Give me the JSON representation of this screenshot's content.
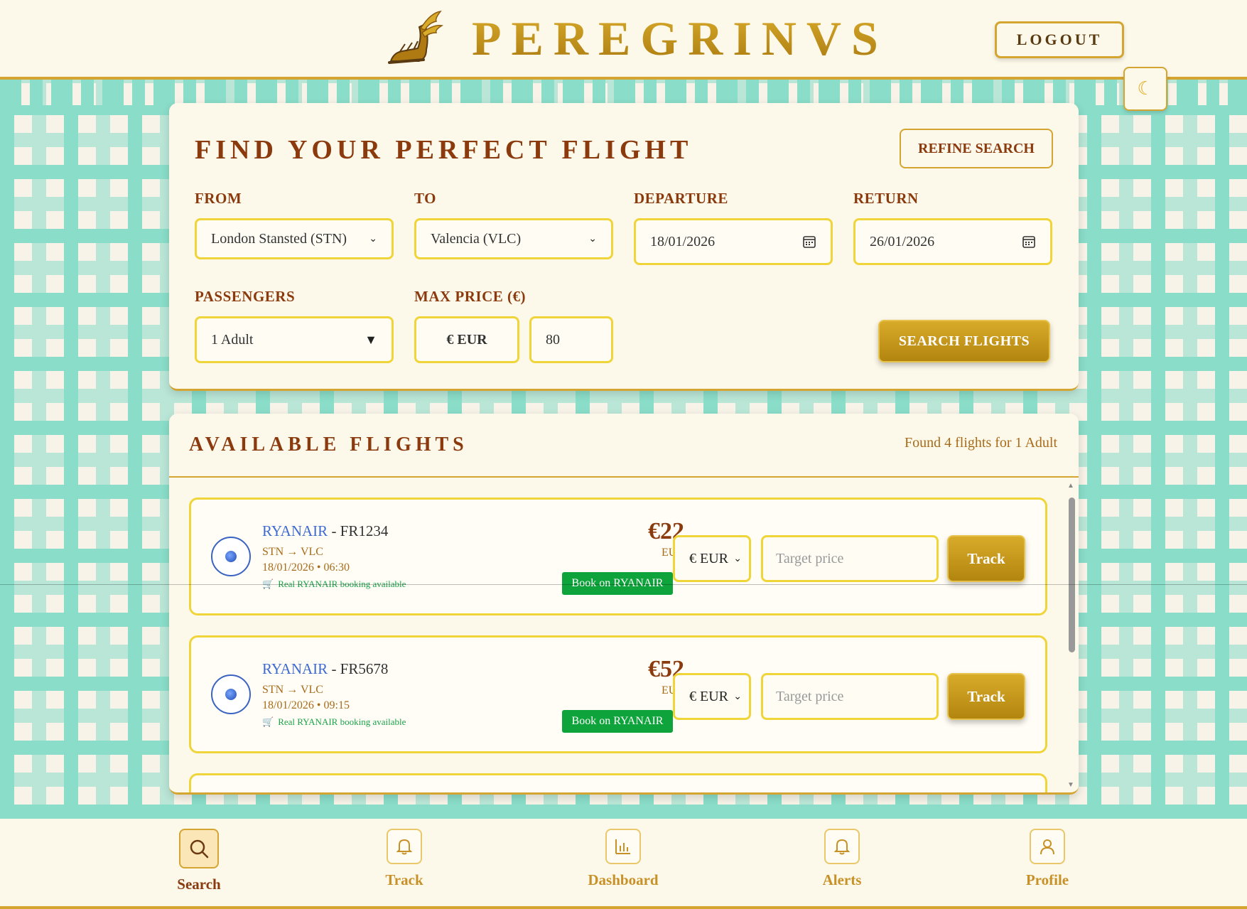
{
  "header": {
    "brand": "PEREGRINVS",
    "logout_label": "LOGOUT",
    "theme_icon": "moon-icon"
  },
  "search": {
    "title": "FIND YOUR PERFECT FLIGHT",
    "refine_label": "REFINE SEARCH",
    "from_label": "FROM",
    "from_value": "London Stansted (STN)",
    "to_label": "TO",
    "to_value": "Valencia (VLC)",
    "departure_label": "DEPARTURE",
    "departure_value": "18/01/2026",
    "return_label": "RETURN",
    "return_value": "26/01/2026",
    "passengers_label": "PASSENGERS",
    "passengers_value": "1 Adult",
    "max_price_label": "MAX PRICE (€)",
    "currency_value": "€ EUR",
    "max_price_value": "80",
    "search_label": "SEARCH FLIGHTS"
  },
  "results": {
    "title": "AVAILABLE FLIGHTS",
    "count_text": "Found 4 flights for 1 Adult",
    "flights": [
      {
        "airline": "RYANAIR",
        "flight_no": " - FR1234",
        "route": "STN → VLC",
        "datetime": "18/01/2026 • 06:30",
        "booking_note": "Real RYANAIR booking available",
        "price": "€22",
        "currency": "EUR",
        "book_label": "Book on RYANAIR",
        "currency_select": "€ EUR",
        "target_placeholder": "Target price",
        "track_label": "Track"
      },
      {
        "airline": "RYANAIR",
        "flight_no": " - FR5678",
        "route": "STN → VLC",
        "datetime": "18/01/2026 • 09:15",
        "booking_note": "Real RYANAIR booking available",
        "price": "€52",
        "currency": "EUR",
        "book_label": "Book on RYANAIR",
        "currency_select": "€ EUR",
        "target_placeholder": "Target price",
        "track_label": "Track"
      }
    ]
  },
  "nav": {
    "items": [
      {
        "label": "Search",
        "icon": "search-icon",
        "active": true
      },
      {
        "label": "Track",
        "icon": "bell-icon"
      },
      {
        "label": "Dashboard",
        "icon": "bar-chart-icon"
      },
      {
        "label": "Alerts",
        "icon": "bell-icon"
      },
      {
        "label": "Profile",
        "icon": "user-icon"
      }
    ]
  },
  "colors": {
    "accent_gold": "#d4a530",
    "title_brown": "#8b3a0e",
    "pattern_teal": "#84dcc8",
    "book_green": "#0fa33c",
    "airline_blue": "#3d6bd1"
  }
}
